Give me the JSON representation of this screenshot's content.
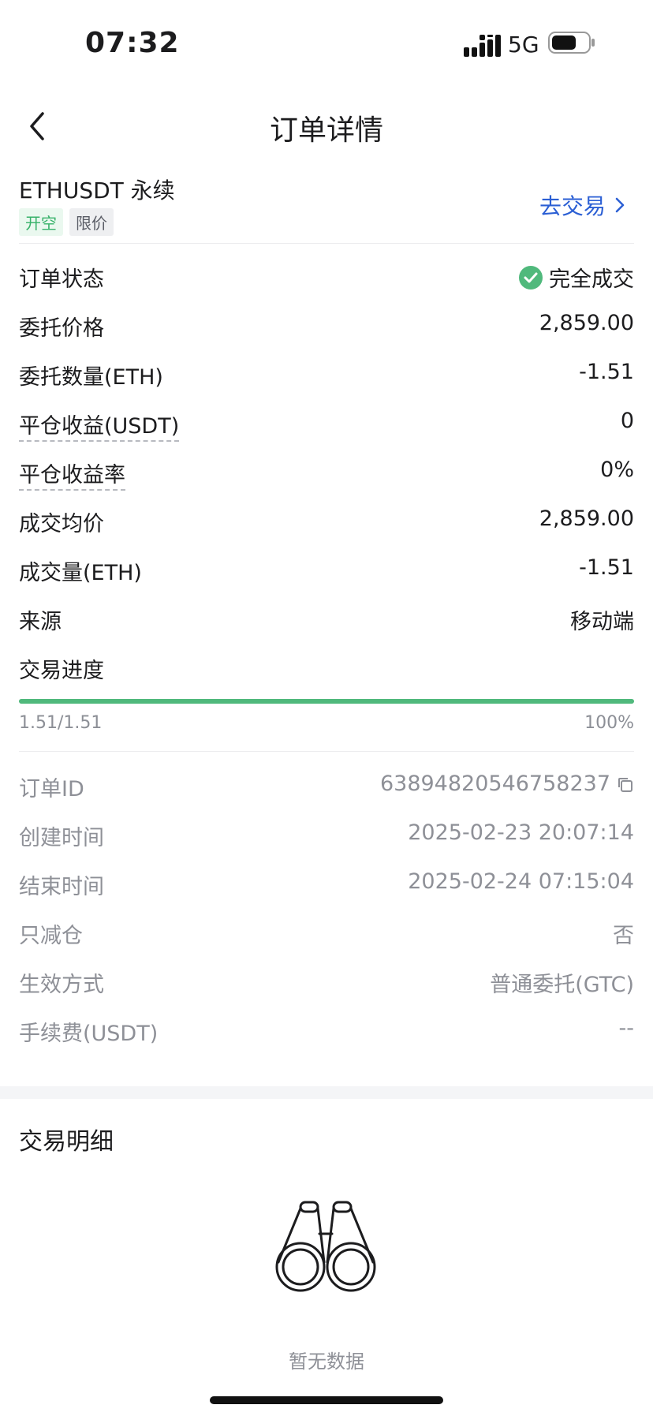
{
  "status_bar": {
    "time": "07:32",
    "network": "5G"
  },
  "nav": {
    "title": "订单详情"
  },
  "header": {
    "symbol": "ETHUSDT 永续",
    "tags": [
      "开空",
      "限价"
    ],
    "trade_link": "去交易"
  },
  "details": [
    {
      "label": "订单状态",
      "value": "完全成交"
    },
    {
      "label": "委托价格",
      "value": "2,859.00"
    },
    {
      "label": "委托数量(ETH)",
      "value": "-1.51"
    },
    {
      "label": "平仓收益(USDT)",
      "value": "0"
    },
    {
      "label": "平仓收益率",
      "value": "0%"
    },
    {
      "label": "成交均价",
      "value": "2,859.00"
    },
    {
      "label": "成交量(ETH)",
      "value": "-1.51"
    },
    {
      "label": "来源",
      "value": "移动端"
    },
    {
      "label": "交易进度",
      "value": ""
    }
  ],
  "progress": {
    "filled_text": "1.51/1.51",
    "percent_text": "100%",
    "fraction": 1.0
  },
  "info": [
    {
      "label": "订单ID",
      "value": "638948205467582​37"
    },
    {
      "label": "创建时间",
      "value": "2025-02-23 20:07:14"
    },
    {
      "label": "结束时间",
      "value": "2025-02-24 07:15:04"
    },
    {
      "label": "只减仓",
      "value": "否"
    },
    {
      "label": "生效方式",
      "value": "普通委托(GTC)"
    },
    {
      "label": "手续费(USDT)",
      "value": "--"
    }
  ],
  "trade_detail": {
    "title": "交易明细",
    "empty_text": "暂无数据"
  },
  "colors": {
    "accent_green": "#50b97c",
    "link_blue": "#2b5fd4"
  }
}
